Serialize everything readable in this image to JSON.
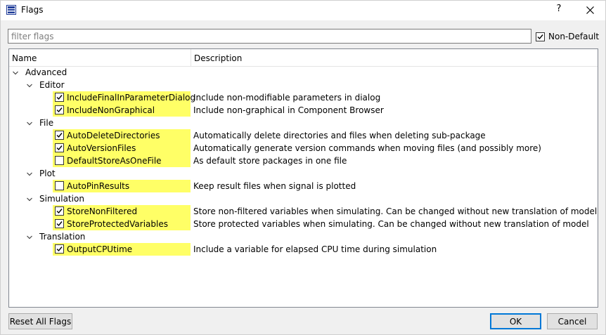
{
  "window": {
    "title": "Flags",
    "help_label": "?"
  },
  "filter": {
    "placeholder": "filter flags",
    "value": ""
  },
  "non_default": {
    "label": "Non-Default",
    "checked": true
  },
  "columns": {
    "name": "Name",
    "description": "Description"
  },
  "root": {
    "label": "Advanced",
    "expanded": true
  },
  "categories": [
    {
      "label": "Editor",
      "flags": [
        {
          "name": "IncludeFinalInParameterDialog",
          "checked": true,
          "description": "Include non-modifiable parameters in dialog"
        },
        {
          "name": "IncludeNonGraphical",
          "checked": true,
          "description": "Include non-graphical in Component Browser"
        }
      ]
    },
    {
      "label": "File",
      "flags": [
        {
          "name": "AutoDeleteDirectories",
          "checked": true,
          "description": "Automatically delete directories and files when deleting sub-package"
        },
        {
          "name": "AutoVersionFiles",
          "checked": true,
          "description": "Automatically generate version commands when moving files (and possibly more)"
        },
        {
          "name": "DefaultStoreAsOneFile",
          "checked": false,
          "description": "As default store packages in one file"
        }
      ]
    },
    {
      "label": "Plot",
      "flags": [
        {
          "name": "AutoPinResults",
          "checked": false,
          "description": "Keep result files when signal is plotted"
        }
      ]
    },
    {
      "label": "Simulation",
      "flags": [
        {
          "name": "StoreNonFiltered",
          "checked": true,
          "description": "Store non-filtered variables when simulating. Can be changed without new translation of model"
        },
        {
          "name": "StoreProtectedVariables",
          "checked": true,
          "description": "Store protected variables when simulating. Can be changed without new translation of model"
        }
      ]
    },
    {
      "label": "Translation",
      "flags": [
        {
          "name": "OutputCPUtime",
          "checked": true,
          "description": "Include a variable for elapsed CPU time during simulation"
        }
      ]
    }
  ],
  "buttons": {
    "reset": "Reset All Flags",
    "ok": "OK",
    "cancel": "Cancel"
  },
  "colors": {
    "flag_highlight": "#ffff66",
    "accent": "#0078d7"
  },
  "icons": {
    "title": "flags-window-icon",
    "close": "close-icon",
    "expand": "chevron-down-icon",
    "check": "check-icon"
  }
}
